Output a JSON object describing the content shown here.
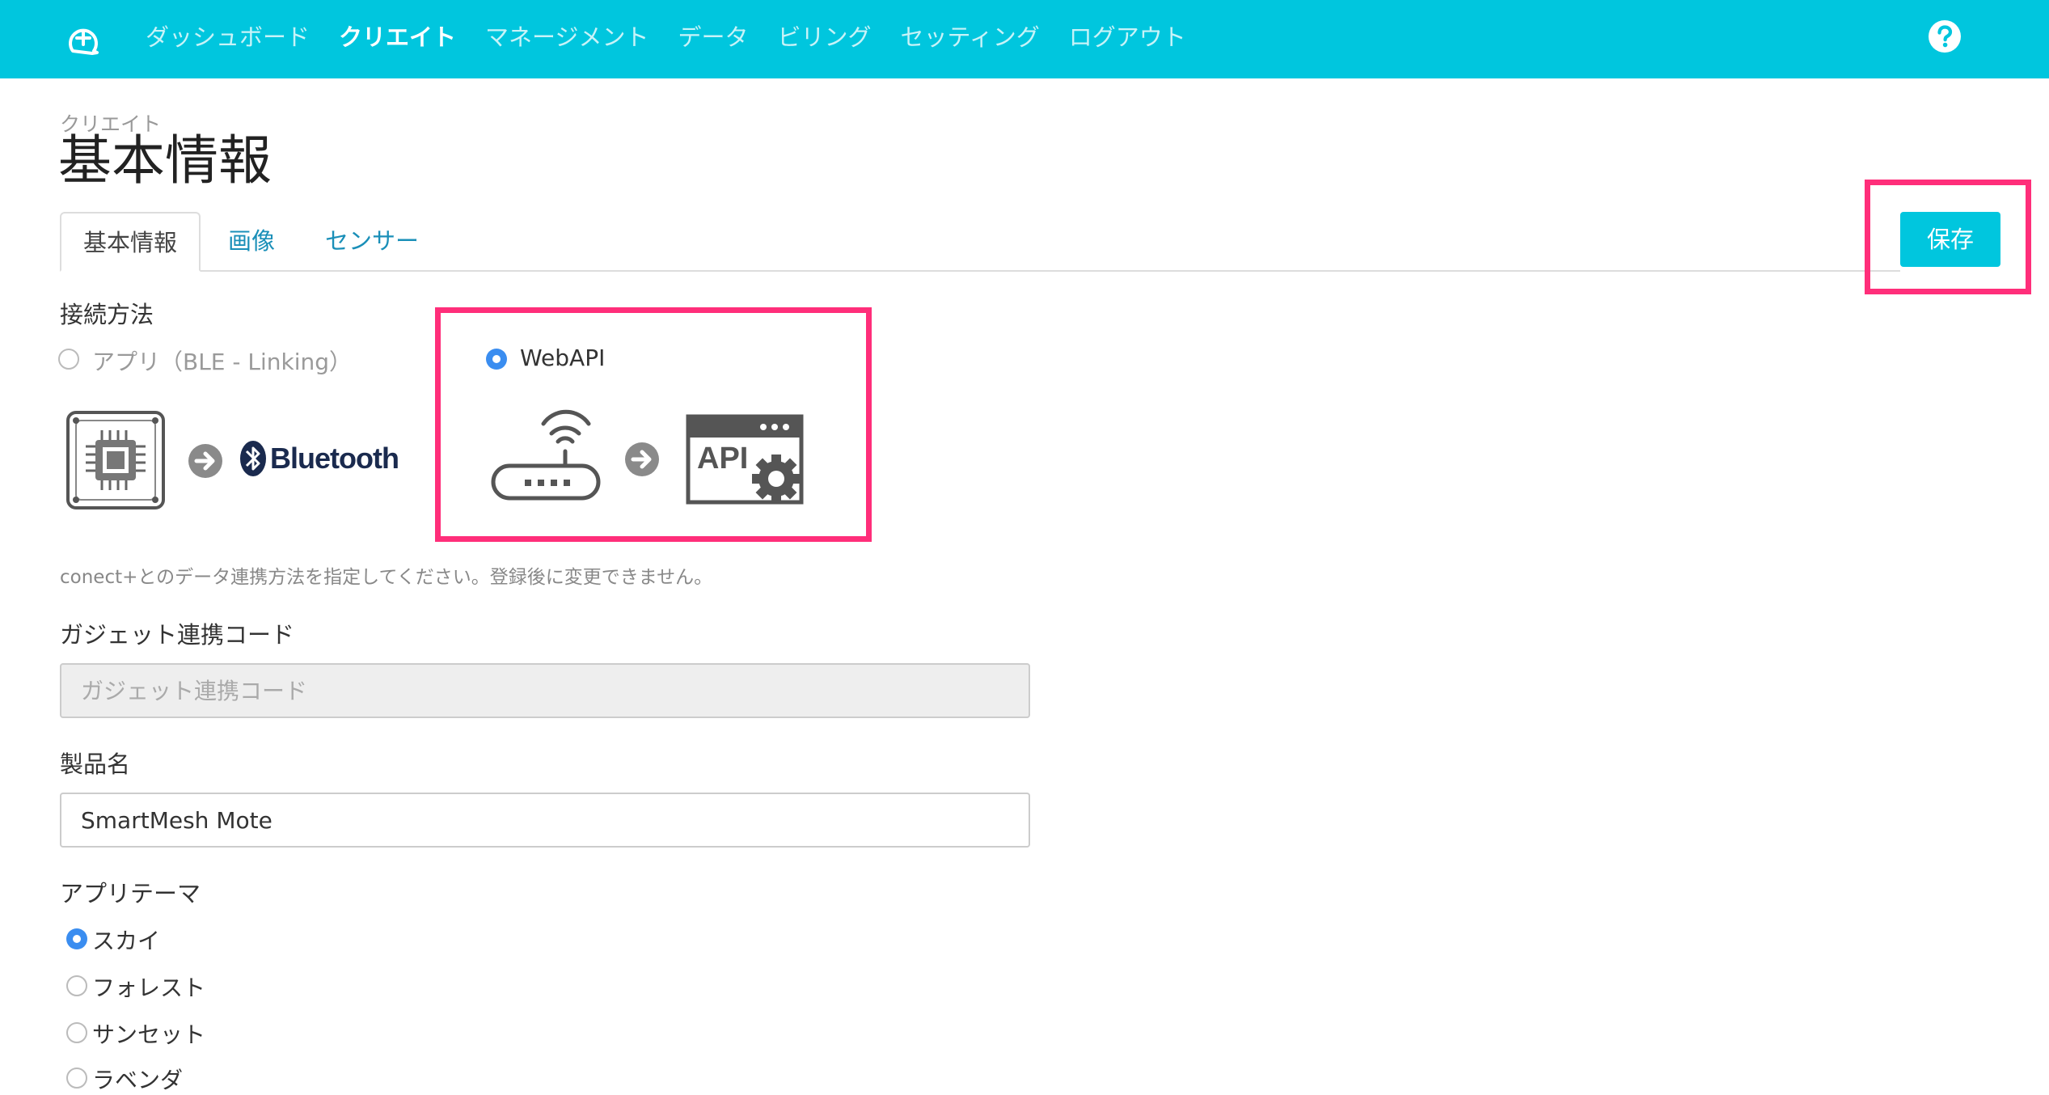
{
  "nav": {
    "items": [
      {
        "label": "ダッシュボード",
        "active": false
      },
      {
        "label": "クリエイト",
        "active": true
      },
      {
        "label": "マネージメント",
        "active": false
      },
      {
        "label": "データ",
        "active": false
      },
      {
        "label": "ビリング",
        "active": false
      },
      {
        "label": "セッティング",
        "active": false
      },
      {
        "label": "ログアウト",
        "active": false
      }
    ],
    "logo_icon": "plus-circle-logo-icon",
    "help_icon": "question-circle-icon",
    "background_color": "#00c6de"
  },
  "page": {
    "breadcrumb": "クリエイト",
    "title": "基本情報"
  },
  "tabs": [
    {
      "label": "基本情報",
      "active": true
    },
    {
      "label": "画像",
      "active": false
    },
    {
      "label": "センサー",
      "active": false
    }
  ],
  "actions": {
    "save_label": "保存"
  },
  "connection": {
    "label": "接続方法",
    "option_app": {
      "label": "アプリ（BLE - Linking）",
      "checked": false,
      "disabled": true
    },
    "option_webapi": {
      "label": "WebAPI",
      "checked": true
    },
    "bluetooth_text": "Bluetooth",
    "api_text": "API",
    "help": "conect+とのデータ連携方法を指定してください。登録後に変更できません。"
  },
  "gadget_code": {
    "label": "ガジェット連携コード",
    "placeholder": "ガジェット連携コード",
    "value": ""
  },
  "product_name": {
    "label": "製品名",
    "value": "SmartMesh Mote"
  },
  "app_theme": {
    "label": "アプリテーマ",
    "options": [
      {
        "label": "スカイ",
        "checked": true
      },
      {
        "label": "フォレスト",
        "checked": false
      },
      {
        "label": "サンセット",
        "checked": false
      },
      {
        "label": "ラベンダ",
        "checked": false
      }
    ]
  },
  "colors": {
    "accent": "#00c6de",
    "highlight": "#ff2e7a",
    "radio_checked": "#3a8df0",
    "link": "#1a8fb8"
  }
}
